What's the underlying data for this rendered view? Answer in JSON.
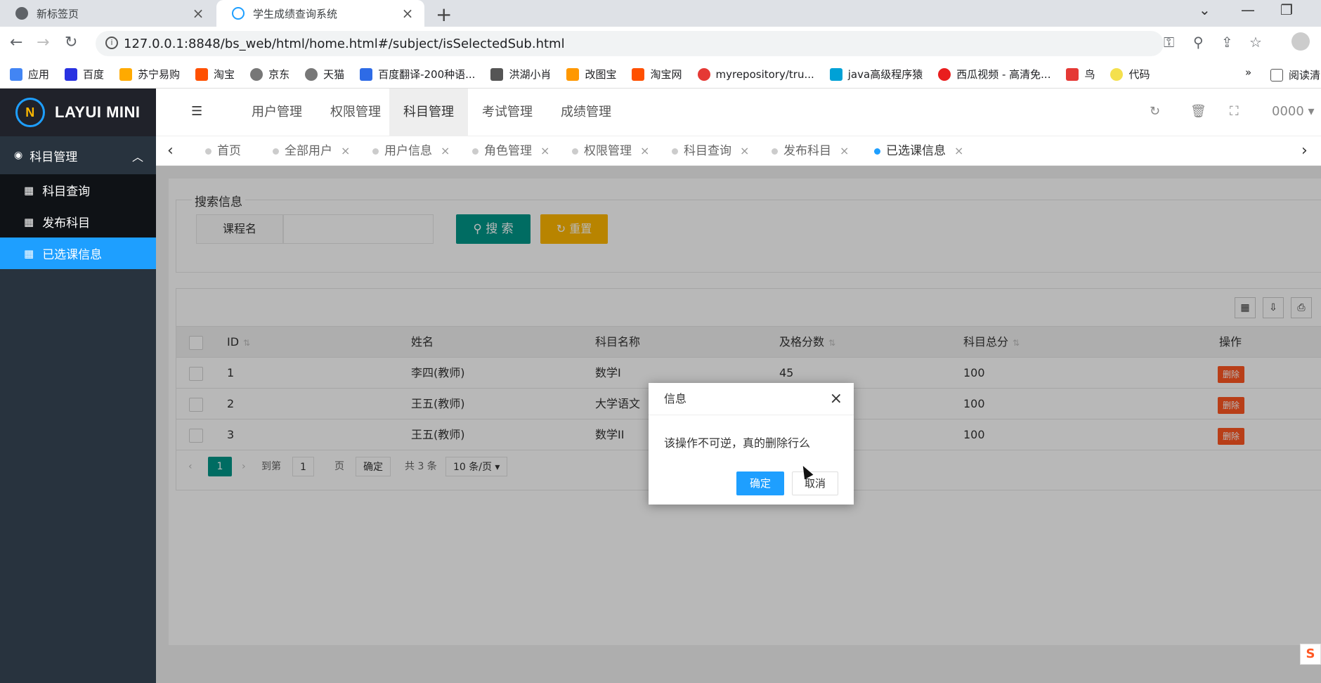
{
  "browser": {
    "tabs": [
      {
        "title": "新标签页",
        "active": false
      },
      {
        "title": "学生成绩查询系统",
        "active": true
      }
    ],
    "new_tab": "+",
    "url": "127.0.0.1:8848/bs_web/html/home.html#/subject/isSelectedSub.html",
    "bookmarks": [
      {
        "label": "应用",
        "color": "#4285f4"
      },
      {
        "label": "百度",
        "color": "#2932e1"
      },
      {
        "label": "苏宁易购",
        "color": "#ffaa00"
      },
      {
        "label": "淘宝",
        "color": "#ff5000"
      },
      {
        "label": "京东",
        "color": "#777777"
      },
      {
        "label": "天猫",
        "color": "#777777"
      },
      {
        "label": "百度翻译-200种语...",
        "color": "#2e6be6"
      },
      {
        "label": "洪湖小肖",
        "color": "#555555"
      },
      {
        "label": "改图宝",
        "color": "#ff9800"
      },
      {
        "label": "淘宝网",
        "color": "#ff5000"
      },
      {
        "label": "myrepository/tru...",
        "color": "#e53935"
      },
      {
        "label": "java高级程序猿",
        "color": "#00a1d6"
      },
      {
        "label": "西瓜视频 - 高清免...",
        "color": "#e91e1e"
      },
      {
        "label": "鸟",
        "color": "#e53935"
      },
      {
        "label": "代码",
        "color": "#f4e04d"
      }
    ],
    "reading_list": "阅读清"
  },
  "app": {
    "logo": "LAYUI MINI",
    "side_menu": {
      "group": "科目管理",
      "items": [
        {
          "label": "科目查询",
          "active": false
        },
        {
          "label": "发布科目",
          "active": false
        },
        {
          "label": "已选课信息",
          "active": true
        }
      ]
    },
    "top_nav": [
      "用户管理",
      "权限管理",
      "科目管理",
      "考试管理",
      "成绩管理"
    ],
    "top_nav_active": "科目管理",
    "user": "0000",
    "page_tabs": [
      {
        "label": "首页",
        "closable": false
      },
      {
        "label": "全部用户",
        "closable": true
      },
      {
        "label": "用户信息",
        "closable": true
      },
      {
        "label": "角色管理",
        "closable": true
      },
      {
        "label": "权限管理",
        "closable": true
      },
      {
        "label": "科目查询",
        "closable": true
      },
      {
        "label": "发布科目",
        "closable": true
      },
      {
        "label": "已选课信息",
        "closable": true,
        "active": true
      }
    ],
    "search": {
      "legend": "搜索信息",
      "field_label": "课程名",
      "field_value": "",
      "search_btn": "搜 索",
      "reset_btn": "重置"
    },
    "table": {
      "columns": [
        "ID",
        "姓名",
        "科目名称",
        "及格分数",
        "科目总分",
        "操作"
      ],
      "rows": [
        {
          "id": "1",
          "name": "李四(教师)",
          "subject": "数学I",
          "pass": "45",
          "total": "100",
          "action": "删除"
        },
        {
          "id": "2",
          "name": "王五(教师)",
          "subject": "大学语文",
          "pass": "",
          "total": "100",
          "action": "删除"
        },
        {
          "id": "3",
          "name": "王五(教师)",
          "subject": "数学II",
          "pass": "",
          "total": "100",
          "action": "删除"
        }
      ]
    },
    "pager": {
      "current": "1",
      "goto_label": "到第",
      "goto_value": "1",
      "page_unit": "页",
      "confirm": "确定",
      "total": "共 3 条",
      "page_size": "10 条/页"
    }
  },
  "dialog": {
    "title": "信息",
    "message": "该操作不可逆，真的删除行么",
    "ok": "确定",
    "cancel": "取消"
  }
}
